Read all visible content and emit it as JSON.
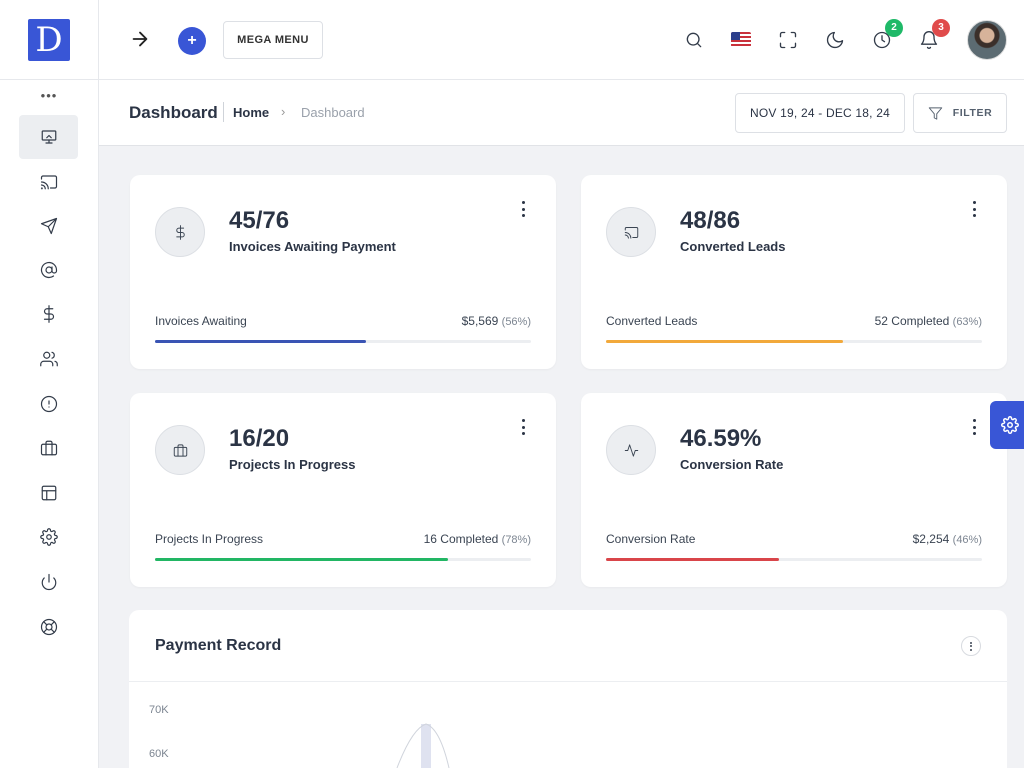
{
  "logo": {
    "letter": "D",
    "color": "#3956d6"
  },
  "sidebar": {
    "more": "•••",
    "items": [
      {
        "icon": "monitor-icon",
        "active": true
      },
      {
        "icon": "cast-icon"
      },
      {
        "icon": "send-icon"
      },
      {
        "icon": "at-sign-icon"
      },
      {
        "icon": "dollar-icon"
      },
      {
        "icon": "users-icon"
      },
      {
        "icon": "alert-circle-icon"
      },
      {
        "icon": "briefcase-icon"
      },
      {
        "icon": "layout-icon"
      },
      {
        "icon": "settings-icon"
      },
      {
        "icon": "power-icon"
      },
      {
        "icon": "lifebuoy-icon"
      }
    ]
  },
  "header": {
    "plus": "+",
    "mega_menu": "MEGA MENU",
    "clock_badge": "2",
    "bell_badge": "3"
  },
  "subheader": {
    "title": "Dashboard",
    "breadcrumb_home": "Home",
    "breadcrumb_sep": "›",
    "breadcrumb_current": "Dashboard",
    "date_range": "NOV 19, 24 - DEC 18, 24",
    "filter": "FILTER"
  },
  "cards": [
    {
      "icon": "dollar-icon",
      "value": "45/76",
      "label": "Invoices Awaiting Payment",
      "progress_label": "Invoices Awaiting",
      "progress_value": "$5,569",
      "progress_pct": "(56%)",
      "fill": 0.56,
      "color": "#3a54b4"
    },
    {
      "icon": "cast-icon",
      "value": "48/86",
      "label": "Converted Leads",
      "progress_label": "Converted Leads",
      "progress_value": "52 Completed",
      "progress_pct": "(63%)",
      "fill": 0.63,
      "color": "#f2a93b"
    },
    {
      "icon": "briefcase-icon",
      "value": "16/20",
      "label": "Projects In Progress",
      "progress_label": "Projects In Progress",
      "progress_value": "16 Completed",
      "progress_pct": "(78%)",
      "fill": 0.78,
      "color": "#22b664"
    },
    {
      "icon": "activity-icon",
      "value": "46.59%",
      "label": "Conversion Rate",
      "progress_label": "Conversion Rate",
      "progress_value": "$2,254",
      "progress_pct": "(46%)",
      "fill": 0.46,
      "color": "#d9454a"
    }
  ],
  "payment": {
    "title": "Payment Record",
    "ticks": [
      "70K",
      "60K"
    ]
  }
}
